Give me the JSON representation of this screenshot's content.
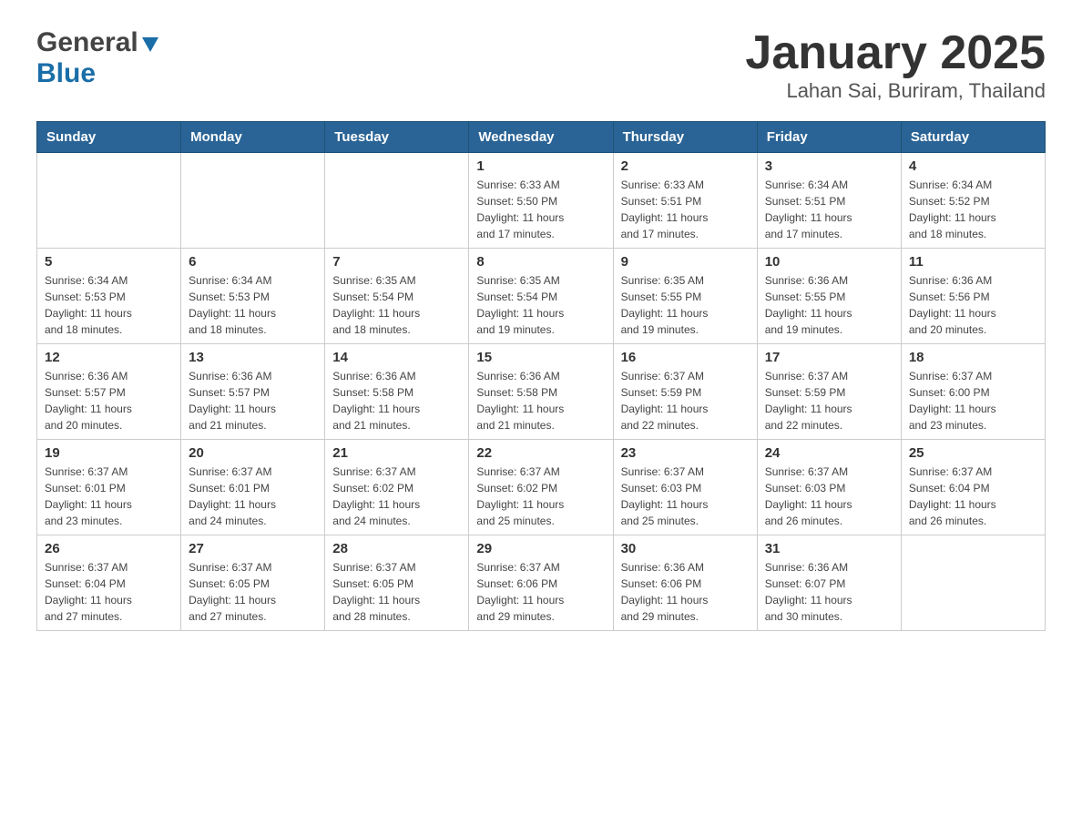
{
  "header": {
    "logo_general": "General",
    "logo_blue": "Blue",
    "title": "January 2025",
    "subtitle": "Lahan Sai, Buriram, Thailand"
  },
  "weekdays": [
    "Sunday",
    "Monday",
    "Tuesday",
    "Wednesday",
    "Thursday",
    "Friday",
    "Saturday"
  ],
  "weeks": [
    [
      {
        "day": "",
        "info": ""
      },
      {
        "day": "",
        "info": ""
      },
      {
        "day": "",
        "info": ""
      },
      {
        "day": "1",
        "info": "Sunrise: 6:33 AM\nSunset: 5:50 PM\nDaylight: 11 hours\nand 17 minutes."
      },
      {
        "day": "2",
        "info": "Sunrise: 6:33 AM\nSunset: 5:51 PM\nDaylight: 11 hours\nand 17 minutes."
      },
      {
        "day": "3",
        "info": "Sunrise: 6:34 AM\nSunset: 5:51 PM\nDaylight: 11 hours\nand 17 minutes."
      },
      {
        "day": "4",
        "info": "Sunrise: 6:34 AM\nSunset: 5:52 PM\nDaylight: 11 hours\nand 18 minutes."
      }
    ],
    [
      {
        "day": "5",
        "info": "Sunrise: 6:34 AM\nSunset: 5:53 PM\nDaylight: 11 hours\nand 18 minutes."
      },
      {
        "day": "6",
        "info": "Sunrise: 6:34 AM\nSunset: 5:53 PM\nDaylight: 11 hours\nand 18 minutes."
      },
      {
        "day": "7",
        "info": "Sunrise: 6:35 AM\nSunset: 5:54 PM\nDaylight: 11 hours\nand 18 minutes."
      },
      {
        "day": "8",
        "info": "Sunrise: 6:35 AM\nSunset: 5:54 PM\nDaylight: 11 hours\nand 19 minutes."
      },
      {
        "day": "9",
        "info": "Sunrise: 6:35 AM\nSunset: 5:55 PM\nDaylight: 11 hours\nand 19 minutes."
      },
      {
        "day": "10",
        "info": "Sunrise: 6:36 AM\nSunset: 5:55 PM\nDaylight: 11 hours\nand 19 minutes."
      },
      {
        "day": "11",
        "info": "Sunrise: 6:36 AM\nSunset: 5:56 PM\nDaylight: 11 hours\nand 20 minutes."
      }
    ],
    [
      {
        "day": "12",
        "info": "Sunrise: 6:36 AM\nSunset: 5:57 PM\nDaylight: 11 hours\nand 20 minutes."
      },
      {
        "day": "13",
        "info": "Sunrise: 6:36 AM\nSunset: 5:57 PM\nDaylight: 11 hours\nand 21 minutes."
      },
      {
        "day": "14",
        "info": "Sunrise: 6:36 AM\nSunset: 5:58 PM\nDaylight: 11 hours\nand 21 minutes."
      },
      {
        "day": "15",
        "info": "Sunrise: 6:36 AM\nSunset: 5:58 PM\nDaylight: 11 hours\nand 21 minutes."
      },
      {
        "day": "16",
        "info": "Sunrise: 6:37 AM\nSunset: 5:59 PM\nDaylight: 11 hours\nand 22 minutes."
      },
      {
        "day": "17",
        "info": "Sunrise: 6:37 AM\nSunset: 5:59 PM\nDaylight: 11 hours\nand 22 minutes."
      },
      {
        "day": "18",
        "info": "Sunrise: 6:37 AM\nSunset: 6:00 PM\nDaylight: 11 hours\nand 23 minutes."
      }
    ],
    [
      {
        "day": "19",
        "info": "Sunrise: 6:37 AM\nSunset: 6:01 PM\nDaylight: 11 hours\nand 23 minutes."
      },
      {
        "day": "20",
        "info": "Sunrise: 6:37 AM\nSunset: 6:01 PM\nDaylight: 11 hours\nand 24 minutes."
      },
      {
        "day": "21",
        "info": "Sunrise: 6:37 AM\nSunset: 6:02 PM\nDaylight: 11 hours\nand 24 minutes."
      },
      {
        "day": "22",
        "info": "Sunrise: 6:37 AM\nSunset: 6:02 PM\nDaylight: 11 hours\nand 25 minutes."
      },
      {
        "day": "23",
        "info": "Sunrise: 6:37 AM\nSunset: 6:03 PM\nDaylight: 11 hours\nand 25 minutes."
      },
      {
        "day": "24",
        "info": "Sunrise: 6:37 AM\nSunset: 6:03 PM\nDaylight: 11 hours\nand 26 minutes."
      },
      {
        "day": "25",
        "info": "Sunrise: 6:37 AM\nSunset: 6:04 PM\nDaylight: 11 hours\nand 26 minutes."
      }
    ],
    [
      {
        "day": "26",
        "info": "Sunrise: 6:37 AM\nSunset: 6:04 PM\nDaylight: 11 hours\nand 27 minutes."
      },
      {
        "day": "27",
        "info": "Sunrise: 6:37 AM\nSunset: 6:05 PM\nDaylight: 11 hours\nand 27 minutes."
      },
      {
        "day": "28",
        "info": "Sunrise: 6:37 AM\nSunset: 6:05 PM\nDaylight: 11 hours\nand 28 minutes."
      },
      {
        "day": "29",
        "info": "Sunrise: 6:37 AM\nSunset: 6:06 PM\nDaylight: 11 hours\nand 29 minutes."
      },
      {
        "day": "30",
        "info": "Sunrise: 6:36 AM\nSunset: 6:06 PM\nDaylight: 11 hours\nand 29 minutes."
      },
      {
        "day": "31",
        "info": "Sunrise: 6:36 AM\nSunset: 6:07 PM\nDaylight: 11 hours\nand 30 minutes."
      },
      {
        "day": "",
        "info": ""
      }
    ]
  ]
}
